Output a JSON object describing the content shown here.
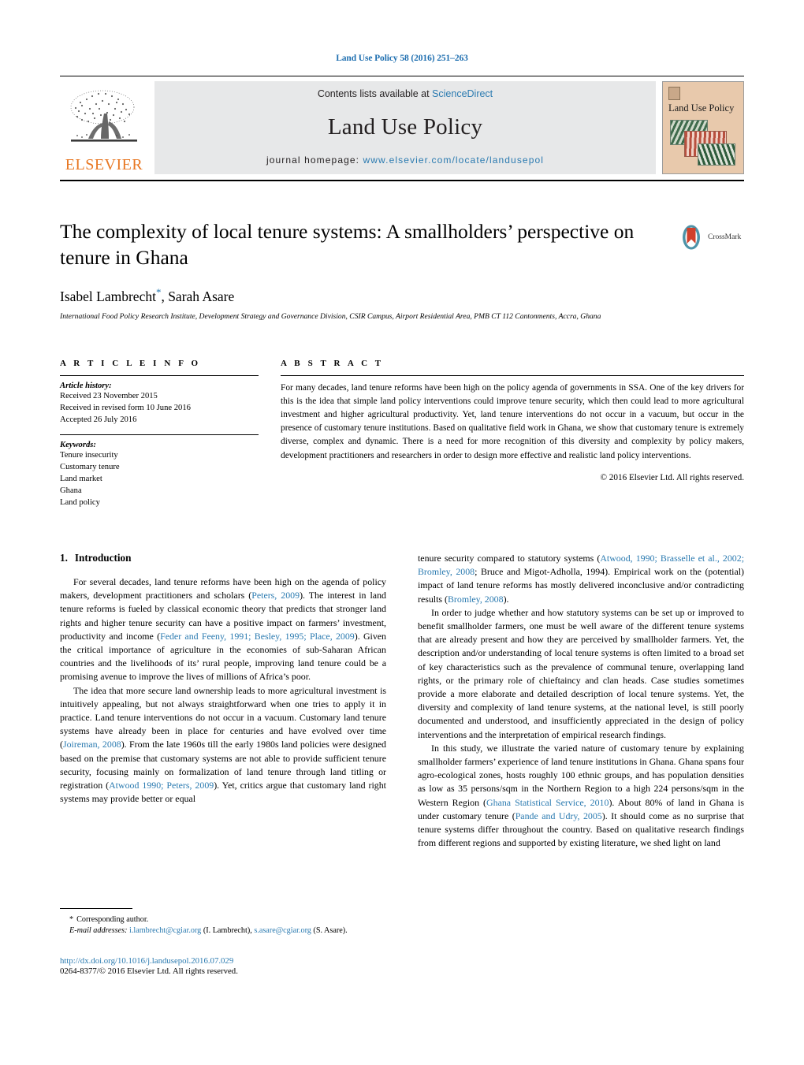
{
  "running_head": "Land Use Policy 58 (2016) 251–263",
  "masthead": {
    "contents_prefix": "Contents lists available at ",
    "sciencedirect": "ScienceDirect",
    "journal_title": "Land Use Policy",
    "homepage_prefix": "journal homepage: ",
    "homepage_url": "www.elsevier.com/locate/landusepol",
    "publisher_logo_text": "ELSEVIER",
    "cover_title": "Land Use Policy",
    "link_color": "#2a7ab0",
    "band_color": "#e7e8e9",
    "elsevier_orange": "#e87722",
    "cover_bg": "#e8c9ac"
  },
  "article": {
    "title": "The complexity of local tenure systems: A smallholders’ perspective on tenure in Ghana",
    "authors": "Isabel Lambrecht, Sarah Asare",
    "author_star": "*",
    "affiliation": "International Food Policy Research Institute, Development Strategy and Governance Division, CSIR Campus, Airport Residential Area, PMB CT 112 Cantonments, Accra, Ghana",
    "crossmark_label": "CrossMark"
  },
  "article_info": {
    "heading": "A R T I C L E   I N F O",
    "history_label": "Article history:",
    "history": [
      "Received 23 November 2015",
      "Received in revised form 10 June 2016",
      "Accepted 26 July 2016"
    ],
    "keywords_label": "Keywords:",
    "keywords": [
      "Tenure insecurity",
      "Customary tenure",
      "Land market",
      "Ghana",
      "Land policy"
    ]
  },
  "abstract": {
    "heading": "A B S T R A C T",
    "text": "For many decades, land tenure reforms have been high on the policy agenda of governments in SSA. One of the key drivers for this is the idea that simple land policy interventions could improve tenure security, which then could lead to more agricultural investment and higher agricultural productivity. Yet, land tenure interventions do not occur in a vacuum, but occur in the presence of customary tenure institutions. Based on qualitative field work in Ghana, we show that customary tenure is extremely diverse, complex and dynamic. There is a need for more recognition of this diversity and complexity by policy makers, development practitioners and researchers in order to design more effective and realistic land policy interventions.",
    "copyright": "© 2016 Elsevier Ltd. All rights reserved."
  },
  "body": {
    "section_number": "1.",
    "section_title": "Introduction",
    "left_paragraphs": [
      {
        "segments": [
          {
            "t": "For several decades, land tenure reforms have been high on the agenda of policy makers, development practitioners and scholars ("
          },
          {
            "t": "Peters, 2009",
            "ref": true
          },
          {
            "t": "). The interest in land tenure reforms is fueled by classical economic theory that predicts that stronger land rights and higher tenure security can have a positive impact on farmers’ investment, productivity and income ("
          },
          {
            "t": "Feder and Feeny, 1991; Besley, 1995; Place, 2009",
            "ref": true
          },
          {
            "t": "). Given the critical importance of agriculture in the economies of sub-Saharan African countries and the livelihoods of its’ rural people, improving land tenure could be a promising avenue to improve the lives of millions of Africa’s poor."
          }
        ]
      },
      {
        "segments": [
          {
            "t": "The idea that more secure land ownership leads to more agricultural investment is intuitively appealing, but not always straightforward when one tries to apply it in practice. Land tenure interventions do not occur in a vacuum. Customary land tenure systems have already been in place for centuries and have evolved over time ("
          },
          {
            "t": "Joireman, 2008",
            "ref": true
          },
          {
            "t": "). From the late 1960s till the early 1980s land policies were designed based on the premise that customary systems are not able to provide sufficient tenure security, focusing mainly on formalization of land tenure through land titling or registration ("
          },
          {
            "t": "Atwood 1990; Peters, 2009",
            "ref": true
          },
          {
            "t": "). Yet, critics argue that customary land right systems may provide better or equal"
          }
        ]
      }
    ],
    "right_paragraphs": [
      {
        "no_indent": true,
        "segments": [
          {
            "t": "tenure security compared to statutory systems ("
          },
          {
            "t": "Atwood, 1990; Brasselle et al., 2002; Bromley, 2008",
            "ref": true
          },
          {
            "t": "; Bruce and Migot-Adholla, 1994). Empirical work on the (potential) impact of land tenure reforms has mostly delivered inconclusive and/or contradicting results ("
          },
          {
            "t": "Bromley, 2008",
            "ref": true
          },
          {
            "t": ")."
          }
        ]
      },
      {
        "segments": [
          {
            "t": "In order to judge whether and how statutory systems can be set up or improved to benefit smallholder farmers, one must be well aware of the different tenure systems that are already present and how they are perceived by smallholder farmers. Yet, the description and/or understanding of local tenure systems is often limited to a broad set of key characteristics such as the prevalence of communal tenure, overlapping land rights, or the primary role of chieftaincy and clan heads. Case studies sometimes provide a more elaborate and detailed description of local tenure systems. Yet, the diversity and complexity of land tenure systems, at the national level, is still poorly documented and understood, and insufficiently appreciated in the design of policy interventions and the interpretation of empirical research findings."
          }
        ]
      },
      {
        "segments": [
          {
            "t": "In this study, we illustrate the varied nature of customary tenure by explaining smallholder farmers’ experience of land tenure institutions in Ghana. Ghana spans four agro-ecological zones, hosts roughly 100 ethnic groups, and has population densities as low as 35 persons/sqm in the Northern Region to a high 224 persons/sqm in the Western Region ("
          },
          {
            "t": "Ghana Statistical Service, 2010",
            "ref": true
          },
          {
            "t": "). About 80% of land in Ghana is under customary tenure ("
          },
          {
            "t": "Pande and Udry, 2005",
            "ref": true
          },
          {
            "t": "). It should come as no surprise that tenure systems differ throughout the country. Based on qualitative research findings from different regions and supported by existing literature, we shed light on land"
          }
        ]
      }
    ]
  },
  "footnote": {
    "star": "*",
    "corresponding": "Corresponding author.",
    "email_label": "E-mail addresses:",
    "email_1": "i.lambrecht@cgiar.org",
    "email_1_name": "(I. Lambrecht),",
    "email_2": "s.asare@cgiar.org",
    "email_2_name": "(S. Asare)."
  },
  "doi": {
    "url": "http://dx.doi.org/10.1016/j.landusepol.2016.07.029",
    "issn_line": "0264-8377/© 2016 Elsevier Ltd. All rights reserved."
  }
}
